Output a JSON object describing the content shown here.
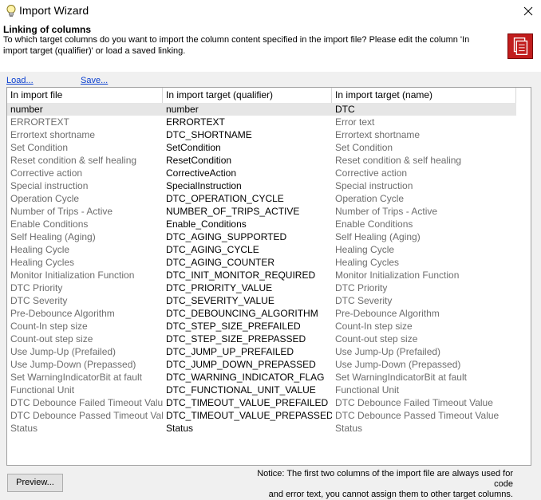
{
  "window": {
    "title": "Import Wizard"
  },
  "header": {
    "title": "Linking of columns",
    "description": "To which target columns do you want to import the column content specified in the import file? Please edit the column 'In import target (qualifier)' or load a saved linking."
  },
  "links": {
    "load": "Load...",
    "save": "Save..."
  },
  "table": {
    "columns": [
      "In import file",
      "In import target (qualifier)",
      "In import target (name)"
    ],
    "rows": [
      [
        "number",
        "number",
        "DTC"
      ],
      [
        "ERRORTEXT",
        "ERRORTEXT",
        "Error text"
      ],
      [
        "Errortext shortname",
        "DTC_SHORTNAME",
        "Errortext shortname"
      ],
      [
        "Set Condition",
        "SetCondition",
        "Set Condition"
      ],
      [
        "Reset condition & self healing",
        "ResetCondition",
        "Reset condition & self healing"
      ],
      [
        "Corrective action",
        "CorrectiveAction",
        "Corrective action"
      ],
      [
        "Special instruction",
        "SpecialInstruction",
        "Special instruction"
      ],
      [
        "Operation Cycle",
        "DTC_OPERATION_CYCLE",
        "Operation Cycle"
      ],
      [
        "Number of Trips - Active",
        "NUMBER_OF_TRIPS_ACTIVE",
        "Number of Trips - Active"
      ],
      [
        "Enable Conditions",
        "Enable_Conditions",
        "Enable Conditions"
      ],
      [
        "Self Healing (Aging)",
        "DTC_AGING_SUPPORTED",
        "Self Healing (Aging)"
      ],
      [
        "Healing Cycle",
        "DTC_AGING_CYCLE",
        "Healing Cycle"
      ],
      [
        "Healing Cycles",
        "DTC_AGING_COUNTER",
        "Healing Cycles"
      ],
      [
        "Monitor Initialization Function",
        "DTC_INIT_MONITOR_REQUIRED",
        "Monitor Initialization Function"
      ],
      [
        "DTC Priority",
        "DTC_PRIORITY_VALUE",
        "DTC Priority"
      ],
      [
        "DTC Severity",
        "DTC_SEVERITY_VALUE",
        "DTC Severity"
      ],
      [
        "Pre-Debounce Algorithm",
        "DTC_DEBOUNCING_ALGORITHM",
        "Pre-Debounce Algorithm"
      ],
      [
        "Count-In step size",
        "DTC_STEP_SIZE_PREFAILED",
        "Count-In step size"
      ],
      [
        "Count-out step size",
        "DTC_STEP_SIZE_PREPASSED",
        "Count-out step size"
      ],
      [
        "Use Jump-Up (Prefailed)",
        "DTC_JUMP_UP_PREFAILED",
        "Use Jump-Up (Prefailed)"
      ],
      [
        "Use Jump-Down (Prepassed)",
        "DTC_JUMP_DOWN_PREPASSED",
        "Use Jump-Down (Prepassed)"
      ],
      [
        "Set WarningIndicatorBit at fault",
        "DTC_WARNING_INDICATOR_FLAG",
        "Set WarningIndicatorBit at fault"
      ],
      [
        "Functional Unit",
        "DTC_FUNCTIONAL_UNIT_VALUE",
        "Functional Unit"
      ],
      [
        "DTC Debounce Failed Timeout Value",
        "DTC_TIMEOUT_VALUE_PREFAILED",
        "DTC Debounce Failed Timeout Value"
      ],
      [
        "DTC Debounce Passed Timeout Value",
        "DTC_TIMEOUT_VALUE_PREPASSED",
        "DTC Debounce Passed Timeout Value"
      ],
      [
        "Status",
        "Status",
        "Status"
      ]
    ]
  },
  "notice": {
    "line1": "Notice: The first two columns of the import file are always used for code",
    "line2": "and error text, you cannot assign them to other target columns."
  },
  "buttons": {
    "preview": "Preview..."
  }
}
